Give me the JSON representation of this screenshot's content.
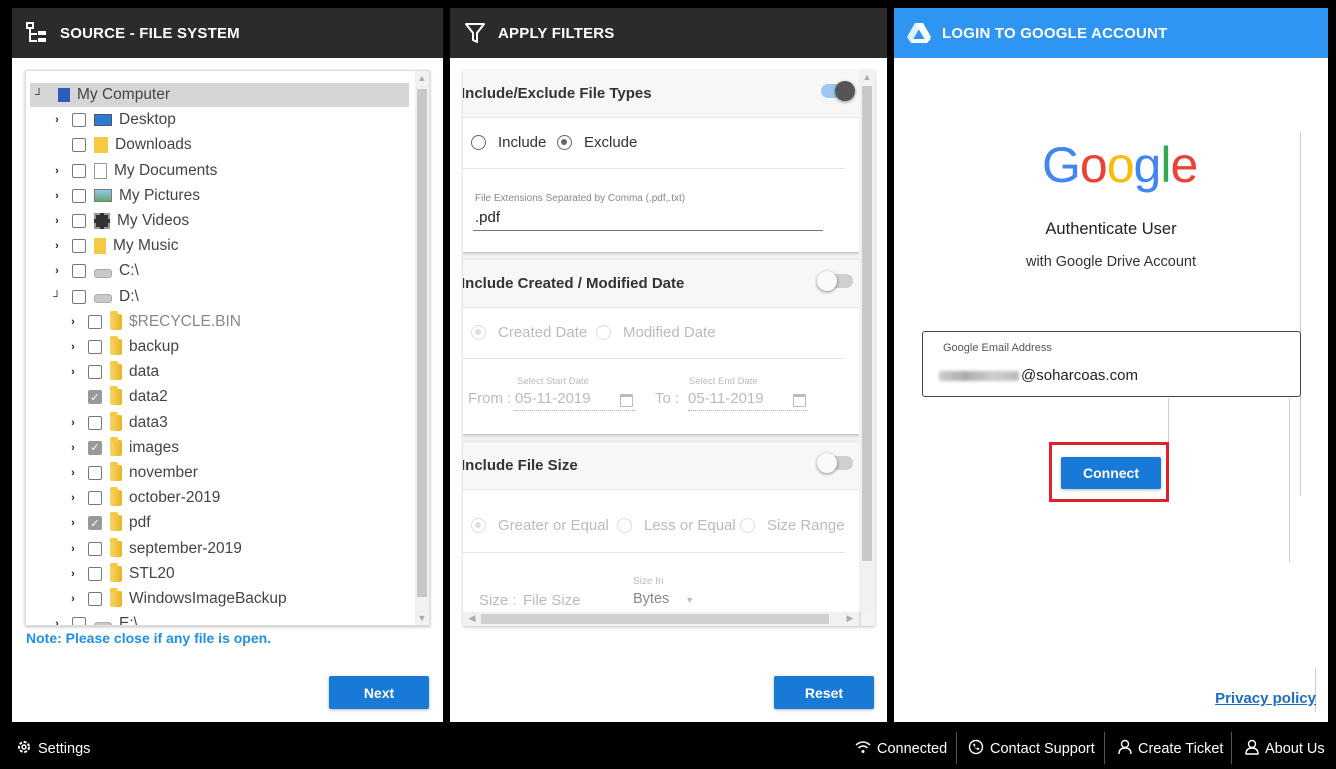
{
  "panels": {
    "source": {
      "title": "SOURCE - FILE SYSTEM",
      "tree": [
        {
          "label": "My Computer",
          "toggle": "┘",
          "checkbox": false,
          "icon": "computer-icon",
          "level": 0
        },
        {
          "label": "Desktop",
          "toggle": "›",
          "checkbox": true,
          "checked": false,
          "icon": "desktop-icon",
          "level": 1
        },
        {
          "label": "Downloads",
          "toggle": "",
          "checkbox": true,
          "checked": false,
          "icon": "downloads-icon",
          "level": 1
        },
        {
          "label": "My Documents",
          "toggle": "›",
          "checkbox": true,
          "checked": false,
          "icon": "documents-icon",
          "level": 1
        },
        {
          "label": "My Pictures",
          "toggle": "›",
          "checkbox": true,
          "checked": false,
          "icon": "pictures-icon",
          "level": 1
        },
        {
          "label": "My Videos",
          "toggle": "›",
          "checkbox": true,
          "checked": false,
          "icon": "videos-icon",
          "level": 1
        },
        {
          "label": "My Music",
          "toggle": "›",
          "checkbox": true,
          "checked": false,
          "icon": "music-icon",
          "level": 1
        },
        {
          "label": "C:\\",
          "toggle": "›",
          "checkbox": true,
          "checked": false,
          "icon": "drive-icon",
          "level": 1
        },
        {
          "label": "D:\\",
          "toggle": "┘",
          "checkbox": true,
          "checked": false,
          "icon": "drive-icon",
          "level": 1
        },
        {
          "label": "$RECYCLE.BIN",
          "toggle": "›",
          "checkbox": true,
          "checked": false,
          "icon": "folder-icon",
          "level": 2,
          "dim": true
        },
        {
          "label": "backup",
          "toggle": "›",
          "checkbox": true,
          "checked": false,
          "icon": "folder-icon",
          "level": 2
        },
        {
          "label": "data",
          "toggle": "›",
          "checkbox": true,
          "checked": false,
          "icon": "folder-icon",
          "level": 2
        },
        {
          "label": "data2",
          "toggle": "",
          "checkbox": true,
          "checked": true,
          "icon": "folder-icon",
          "level": 2
        },
        {
          "label": "data3",
          "toggle": "›",
          "checkbox": true,
          "checked": false,
          "icon": "folder-icon",
          "level": 2
        },
        {
          "label": "images",
          "toggle": "›",
          "checkbox": true,
          "checked": true,
          "icon": "folder-icon",
          "level": 2
        },
        {
          "label": "november",
          "toggle": "›",
          "checkbox": true,
          "checked": false,
          "icon": "folder-icon",
          "level": 2
        },
        {
          "label": "october-2019",
          "toggle": "›",
          "checkbox": true,
          "checked": false,
          "icon": "folder-icon",
          "level": 2
        },
        {
          "label": "pdf",
          "toggle": "›",
          "checkbox": true,
          "checked": true,
          "icon": "folder-icon",
          "level": 2
        },
        {
          "label": "september-2019",
          "toggle": "›",
          "checkbox": true,
          "checked": false,
          "icon": "folder-icon",
          "level": 2
        },
        {
          "label": "STL20",
          "toggle": "›",
          "checkbox": true,
          "checked": false,
          "icon": "folder-icon",
          "level": 2
        },
        {
          "label": "WindowsImageBackup",
          "toggle": "›",
          "checkbox": true,
          "checked": false,
          "icon": "folder-icon",
          "level": 2
        },
        {
          "label": "E:\\",
          "toggle": "›",
          "checkbox": true,
          "checked": false,
          "icon": "drive-icon",
          "level": 1
        }
      ],
      "note": "Note: Please close if any file is open.",
      "next_label": "Next"
    },
    "filters": {
      "title": "APPLY FILTERS",
      "file_types": {
        "heading": "Include/Exclude File Types",
        "enabled": true,
        "include_label": "Include",
        "exclude_label": "Exclude",
        "selected": "Exclude",
        "ext_label": "File Extensions Separated by Comma (.pdf,.txt)",
        "ext_value": ".pdf"
      },
      "date": {
        "heading": "Include Created / Modified Date",
        "enabled": false,
        "created_label": "Created Date",
        "modified_label": "Modified Date",
        "from_label": "From :",
        "to_label": "To :",
        "start_label": "Select Start Date",
        "end_label": "Select End Date",
        "start_value": "05-11-2019",
        "end_value": "05-11-2019"
      },
      "size": {
        "heading": "Include File Size",
        "enabled": false,
        "opt1": "Greater or Equal",
        "opt2": "Less or Equal",
        "opt3": "Size Range",
        "size_label": "Size :",
        "size_placeholder": "File Size",
        "size_in_label": "Size In",
        "unit": "Bytes"
      },
      "reset_label": "Reset"
    },
    "login": {
      "title": "LOGIN TO GOOGLE ACCOUNT",
      "logo_letters": [
        "G",
        "o",
        "o",
        "g",
        "l",
        "e"
      ],
      "logo_colors": [
        "#4285F4",
        "#EA4335",
        "#FBBC05",
        "#4285F4",
        "#34A853",
        "#EA4335"
      ],
      "auth_title": "Authenticate User",
      "auth_sub": "with Google Drive Account",
      "email_label": "Google Email Address",
      "email_domain": "@soharcoas.com",
      "connect_label": "Connect",
      "privacy_label": "Privacy policy"
    }
  },
  "footer": {
    "settings": "Settings",
    "connected": "Connected",
    "contact": "Contact Support",
    "ticket": "Create Ticket",
    "about": "About Us"
  },
  "colors": {
    "accent": "#1979d6",
    "header_blue": "#2f95f2",
    "header_dark": "#2b2b2b",
    "highlight": "#e0202a",
    "note": "#2090e0"
  }
}
